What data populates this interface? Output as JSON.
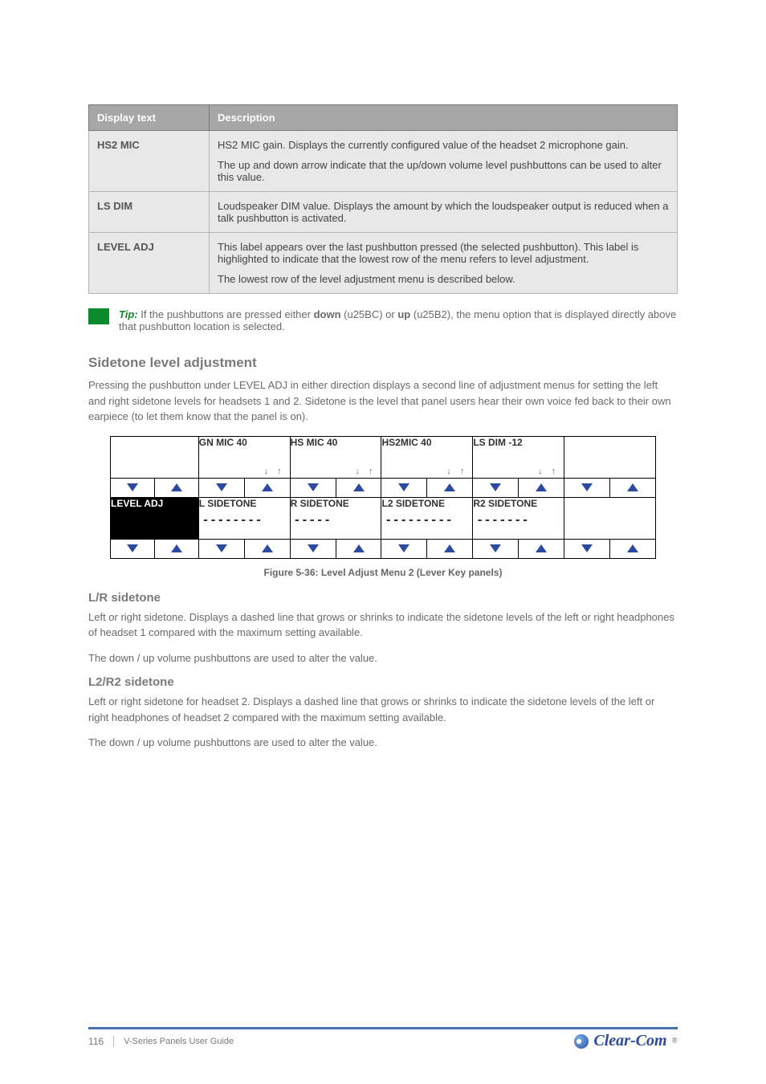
{
  "table": {
    "headers": [
      "Display text",
      "Description"
    ],
    "rows": [
      {
        "label": "HS2 MIC",
        "paras": [
          "HS2 MIC gain. Displays the currently configured value of the headset 2 microphone gain.",
          "The up and down arrow indicate that the up/down volume level pushbuttons can be used to alter this value."
        ]
      },
      {
        "label": "LS DIM",
        "paras": [
          "Loudspeaker DIM value. Displays the amount by which the loudspeaker output is reduced when a talk pushbutton is activated."
        ]
      },
      {
        "label": "LEVEL ADJ",
        "paras": [
          "This label appears over the last pushbutton pressed (the selected pushbutton). This label is highlighted to indicate that the lowest row of the menu refers to level adjustment.",
          "The lowest row of the level adjustment menu is described below."
        ]
      }
    ]
  },
  "tip": {
    "label": "Tip:",
    "text_before": "If the pushbuttons are pressed either ",
    "down": "down",
    "middle": " (u25BC) or ",
    "up": "up",
    "text_after": " (u25B2), the menu option that is displayed directly above that pushbutton location is selected."
  },
  "s1": {
    "heading": "Sidetone level adjustment",
    "p1": "Pressing the pushbutton under LEVEL ADJ in either direction displays a second line of adjustment menus for setting the left and right sidetone levels for headsets 1 and 2. Sidetone is the level that panel users hear their own voice fed back to their own earpiece (to let them know that the panel is on)."
  },
  "diagram": {
    "row1": [
      "",
      "GN MIC  40",
      "HS MIC  40",
      "HS2MIC  40",
      "LS DIM  -12",
      ""
    ],
    "row2_label": "LEVEL ADJ",
    "row2": [
      "L SIDETONE",
      "R SIDETONE",
      "L2 SIDETONE",
      "R2 SIDETONE",
      ""
    ],
    "sliders": [
      "--------",
      "-----",
      "---------",
      "-------",
      ""
    ]
  },
  "figure_caption": "Figure 5-36: Level Adjust Menu 2 (Lever Key panels)",
  "s2": {
    "heading": "L/R sidetone",
    "p1": "Left or right sidetone. Displays a dashed line that grows or shrinks to indicate the sidetone levels of the left or right headphones of headset 1 compared with the maximum setting available.",
    "p2": "The down / up volume pushbuttons are used to alter the value."
  },
  "s3": {
    "heading": "L2/R2 sidetone",
    "p1": "Left or right sidetone for headset 2. Displays a dashed line that grows or shrinks to indicate the sidetone levels of the left or right headphones of headset 2 compared with the maximum setting available.",
    "p2": "The down / up volume pushbuttons are used to alter the value."
  },
  "footer": {
    "page": "116",
    "title": "V-Series Panels User Guide",
    "brand": "Clear-Com"
  }
}
